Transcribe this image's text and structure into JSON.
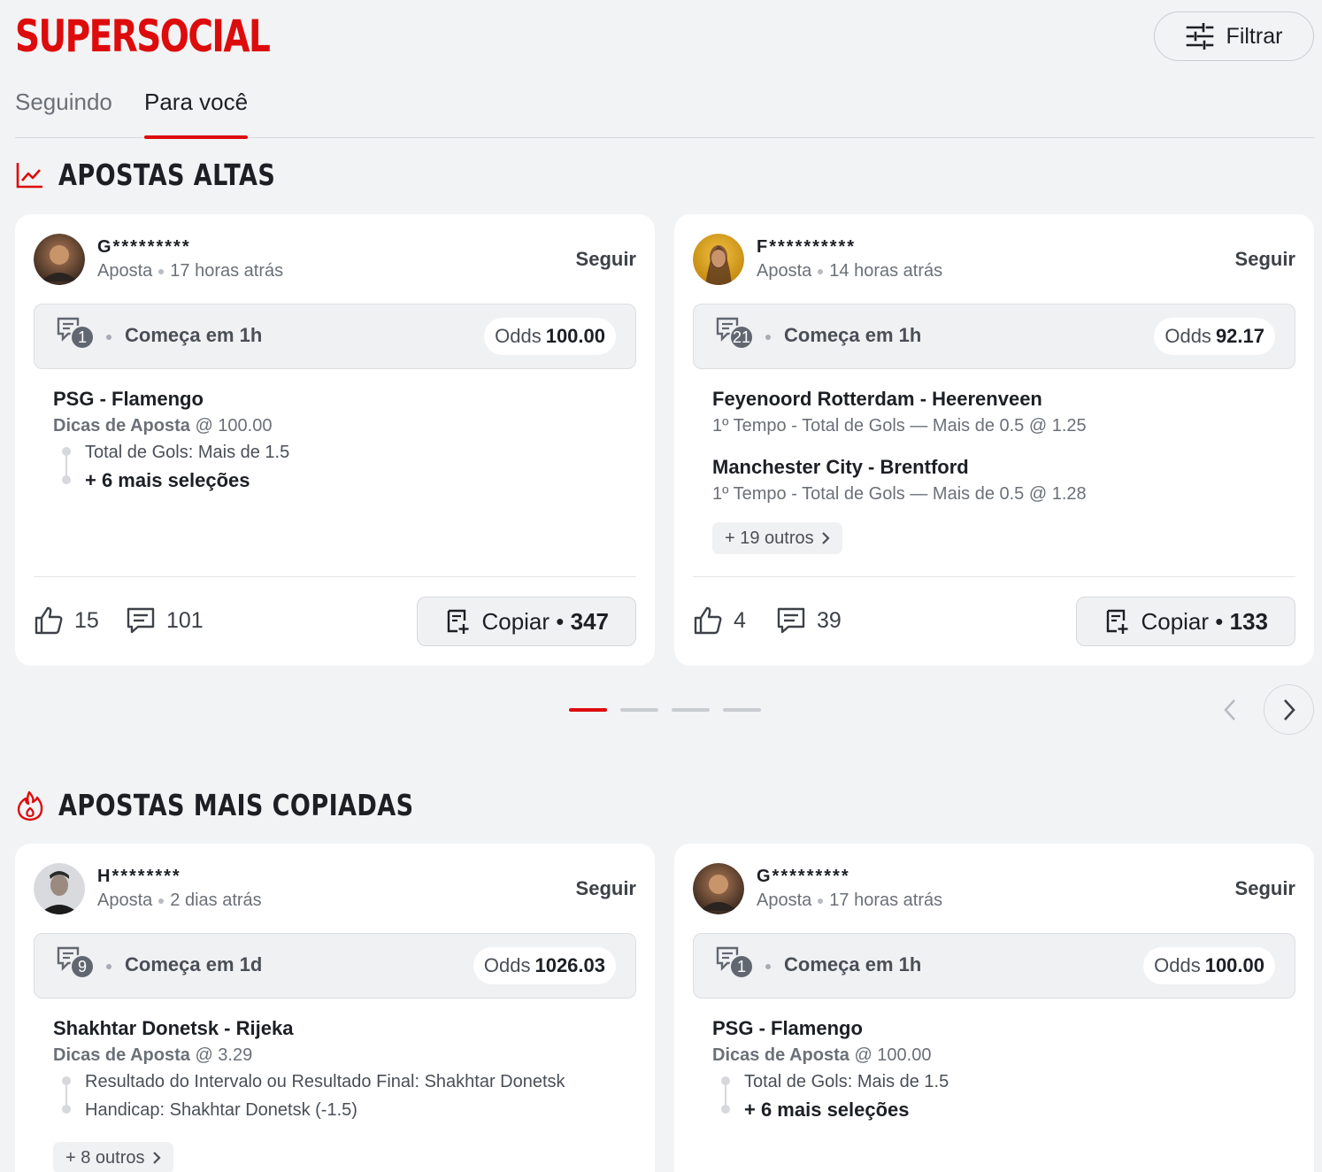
{
  "brand": {
    "logo": "SUPERSOCIAL",
    "accent": "#dd0b0b"
  },
  "header": {
    "filter_label": "Filtrar"
  },
  "tabs": [
    {
      "label": "Seguindo",
      "active": false
    },
    {
      "label": "Para você",
      "active": true
    }
  ],
  "sections": {
    "high": {
      "title": "APOSTAS ALTAS"
    },
    "copied": {
      "title": "APOSTAS MAIS COPIADAS"
    }
  },
  "cards": [
    {
      "user": "G*********",
      "type": "Aposta",
      "time": "17 horas atrás",
      "follow": "Seguir",
      "selections_count": "1",
      "starts": "Começa em 1h",
      "odds_label": "Odds",
      "odds": "100.00",
      "match": "PSG - Flamengo",
      "market_bold": "Dicas de Aposta",
      "market_rest": "@ 100.00",
      "lines": [
        "Total de Gols: Mais de 1.5",
        "+ 6 mais seleções"
      ],
      "likes": "15",
      "comments": "101",
      "copy_label": "Copiar",
      "copy_count": "347"
    },
    {
      "user": "F**********",
      "type": "Aposta",
      "time": "14 horas atrás",
      "follow": "Seguir",
      "selections_count": "21",
      "starts": "Começa em 1h",
      "odds_label": "Odds",
      "odds": "92.17",
      "match1": "Feyenoord Rotterdam - Heerenveen",
      "detail1": "1º Tempo - Total de Gols — Mais de 0.5 @ 1.25",
      "match2": "Manchester City - Brentford",
      "detail2": "1º Tempo - Total de Gols — Mais de 0.5 @ 1.28",
      "others": "+ 19 outros",
      "likes": "4",
      "comments": "39",
      "copy_label": "Copiar",
      "copy_count": "133"
    },
    {
      "user": "H********",
      "type": "Aposta",
      "time": "2 dias atrás",
      "follow": "Seguir",
      "selections_count": "9",
      "starts": "Começa em 1d",
      "odds_label": "Odds",
      "odds": "1026.03",
      "match": "Shakhtar Donetsk - Rijeka",
      "market_bold": "Dicas de Aposta",
      "market_rest": "@ 3.29",
      "lines": [
        "Resultado do Intervalo ou Resultado Final: Shakhtar Donetsk",
        "Handicap: Shakhtar Donetsk (-1.5)"
      ],
      "others": "+ 8 outros"
    },
    {
      "user": "G*********",
      "type": "Aposta",
      "time": "17 horas atrás",
      "follow": "Seguir",
      "selections_count": "1",
      "starts": "Começa em 1h",
      "odds_label": "Odds",
      "odds": "100.00",
      "match": "PSG - Flamengo",
      "market_bold": "Dicas de Aposta",
      "market_rest": "@ 100.00",
      "lines": [
        "Total de Gols: Mais de 1.5",
        "+ 6 mais seleções"
      ]
    }
  ],
  "carousel": {
    "pages": 4,
    "active": 1
  },
  "icons": [
    "sliders-icon",
    "trend-chart-icon",
    "flame-icon",
    "betslip-icon",
    "thumbs-up-icon",
    "comment-icon",
    "copy-slip-icon",
    "chevron-left-icon",
    "chevron-right-icon"
  ]
}
